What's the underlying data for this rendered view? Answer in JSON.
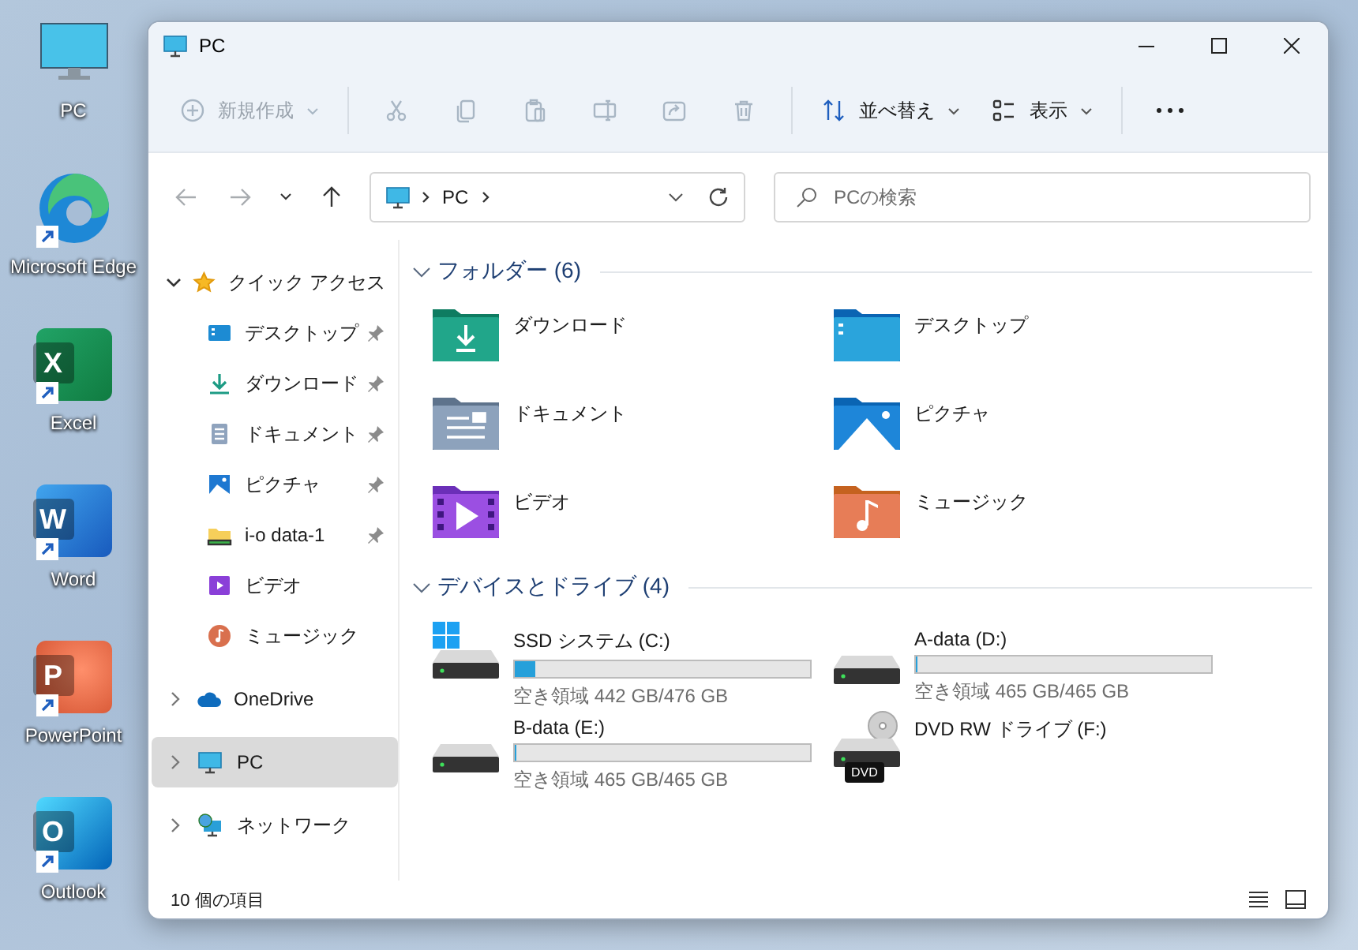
{
  "desktop": {
    "icons": [
      {
        "kind": "pc",
        "label": "PC",
        "shortcut": false
      },
      {
        "kind": "edge",
        "label": "Microsoft Edge",
        "shortcut": true
      },
      {
        "kind": "excel",
        "label": "Excel",
        "letter": "X",
        "shortcut": true
      },
      {
        "kind": "word",
        "label": "Word",
        "letter": "W",
        "shortcut": true
      },
      {
        "kind": "powerpoint",
        "label": "PowerPoint",
        "letter": "P",
        "shortcut": true
      },
      {
        "kind": "outlook",
        "label": "Outlook",
        "letter": "O",
        "shortcut": true
      }
    ]
  },
  "window": {
    "title": "PC"
  },
  "toolbar": {
    "items": [
      {
        "kind": "new",
        "label": "新規作成",
        "dropdown": true,
        "disabled": true
      },
      {
        "kind": "separator"
      },
      {
        "kind": "cut",
        "disabled": true
      },
      {
        "kind": "copy",
        "disabled": true
      },
      {
        "kind": "paste",
        "disabled": true
      },
      {
        "kind": "rename",
        "disabled": true
      },
      {
        "kind": "share",
        "disabled": true
      },
      {
        "kind": "delete",
        "disabled": true
      },
      {
        "kind": "separator"
      },
      {
        "kind": "sort",
        "label": "並べ替え",
        "dropdown": true,
        "disabled": false
      },
      {
        "kind": "view",
        "label": "表示",
        "dropdown": true,
        "disabled": false
      },
      {
        "kind": "separator"
      },
      {
        "kind": "more",
        "disabled": false
      }
    ]
  },
  "navigation": {
    "buttons": [
      {
        "kind": "back",
        "disabled": true
      },
      {
        "kind": "forward",
        "disabled": true
      },
      {
        "kind": "recent",
        "disabled": false
      },
      {
        "kind": "up",
        "disabled": false
      }
    ]
  },
  "address_bar": {
    "path": [
      "PC"
    ]
  },
  "search": {
    "placeholder": "PCの検索"
  },
  "sidebar": {
    "items": [
      {
        "kind": "star",
        "label": "クイック アクセス",
        "expanded": true,
        "selected": false,
        "children": [
          {
            "kind": "desktop",
            "label": "デスクトップ",
            "pinned": true
          },
          {
            "kind": "downloads",
            "label": "ダウンロード",
            "pinned": true
          },
          {
            "kind": "documents",
            "label": "ドキュメント",
            "pinned": true
          },
          {
            "kind": "pictures",
            "label": "ピクチャ",
            "pinned": true
          },
          {
            "kind": "folder",
            "label": "i-o data-1",
            "pinned": true
          },
          {
            "kind": "videos",
            "label": "ビデオ",
            "pinned": false
          },
          {
            "kind": "music",
            "label": "ミュージック",
            "pinned": false
          }
        ]
      },
      {
        "kind": "cloud",
        "label": "OneDrive",
        "expanded": false,
        "selected": false
      },
      {
        "kind": "pc",
        "label": "PC",
        "expanded": false,
        "selected": true
      },
      {
        "kind": "network",
        "label": "ネットワーク",
        "expanded": false,
        "selected": false
      }
    ]
  },
  "folders": {
    "title": "フォルダー (6)",
    "expanded": true,
    "items": [
      {
        "kind": "downloads",
        "name": "ダウンロード"
      },
      {
        "kind": "desktop",
        "name": "デスクトップ"
      },
      {
        "kind": "documents",
        "name": "ドキュメント"
      },
      {
        "kind": "pictures",
        "name": "ピクチャ"
      },
      {
        "kind": "videos",
        "name": "ビデオ"
      },
      {
        "kind": "music",
        "name": "ミュージック"
      }
    ]
  },
  "drives": {
    "title": "デバイスとドライブ (4)",
    "expanded": true,
    "items": [
      {
        "kind": "system",
        "name": "SSD システム (C:)",
        "level": 0.07,
        "free": "空き領域 442 GB/476 GB"
      },
      {
        "kind": "hdd",
        "name": "A-data (D:)",
        "level": 0,
        "free": "空き領域 465 GB/465 GB"
      },
      {
        "kind": "hdd",
        "name": "B-data (E:)",
        "level": 0,
        "free": "空き領域 465 GB/465 GB"
      },
      {
        "kind": "dvd",
        "name": "DVD RW ドライブ (F:)",
        "badge": "DVD"
      }
    ]
  },
  "status_bar": {
    "text": "10 個の項目"
  }
}
